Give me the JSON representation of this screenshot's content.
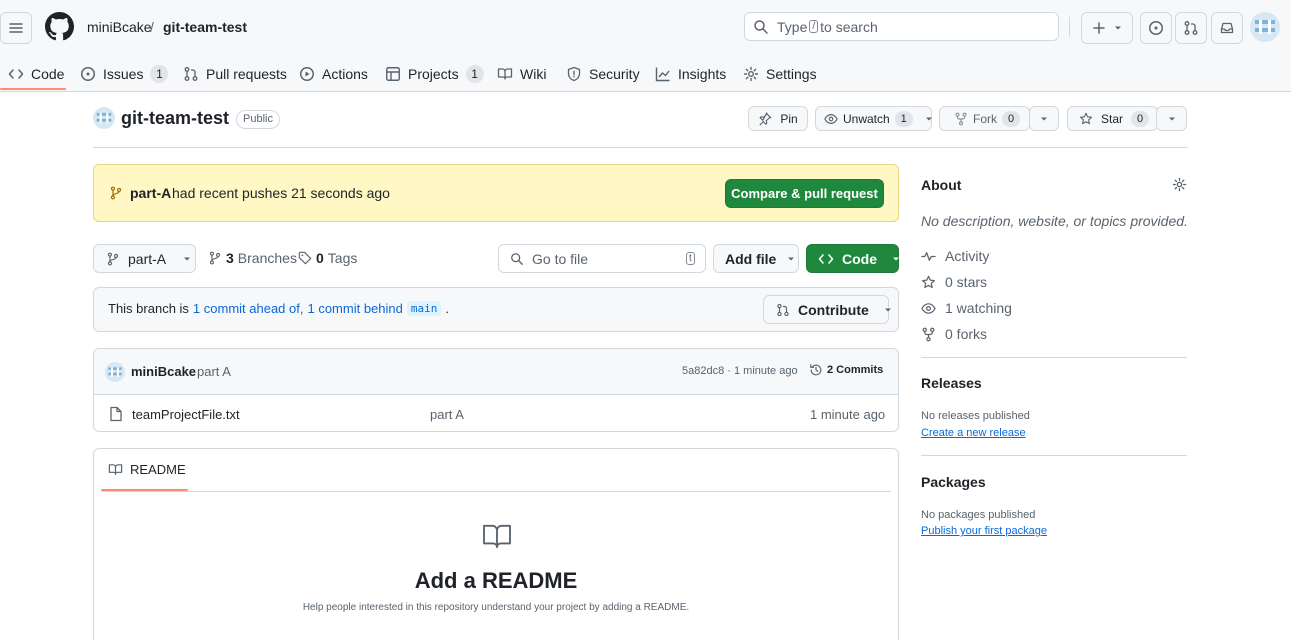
{
  "header": {
    "owner": "miniBcake",
    "separator": "/",
    "repo": "git-team-test",
    "search_prefix": "Type",
    "search_key": "/",
    "search_suffix": "to search"
  },
  "tabs": [
    {
      "label": "Code",
      "icon": "code-icon"
    },
    {
      "label": "Issues",
      "icon": "issue-opened-icon",
      "count": "1"
    },
    {
      "label": "Pull requests",
      "icon": "git-pull-request-icon"
    },
    {
      "label": "Actions",
      "icon": "play-icon"
    },
    {
      "label": "Projects",
      "icon": "table-icon",
      "count": "1"
    },
    {
      "label": "Wiki",
      "icon": "book-icon"
    },
    {
      "label": "Security",
      "icon": "shield-icon"
    },
    {
      "label": "Insights",
      "icon": "graph-icon"
    },
    {
      "label": "Settings",
      "icon": "gear-icon"
    }
  ],
  "repo_header": {
    "name": "git-team-test",
    "visibility": "Public",
    "pin_label": "Pin",
    "unwatch_label": "Unwatch",
    "watch_count": "1",
    "fork_label": "Fork",
    "fork_count": "0",
    "star_label": "Star",
    "star_count": "0"
  },
  "banner": {
    "branch": "part-A",
    "text": "had recent pushes 21 seconds ago",
    "button": "Compare & pull request"
  },
  "toolbar": {
    "branch": "part-A",
    "branches_count": "3",
    "branches_label": "Branches",
    "tags_count": "0",
    "tags_label": "Tags",
    "goto_placeholder": "Go to file",
    "goto_key": "t",
    "add_file": "Add file",
    "code": "Code"
  },
  "branch_status": {
    "prefix": "This branch is",
    "ahead": "1 commit ahead of,",
    "behind": "1 commit behind",
    "base": "main",
    "suffix": ".",
    "contribute": "Contribute"
  },
  "latest_commit": {
    "author": "miniBcake",
    "message": "part A",
    "sha_time": "5a82dc8 · 1 minute ago",
    "commits_label": "2 Commits"
  },
  "files": [
    {
      "name": "teamProjectFile.txt",
      "message": "part A",
      "time": "1 minute ago"
    }
  ],
  "readme": {
    "tab": "README",
    "title": "Add a README",
    "description": "Help people interested in this repository understand your project by adding a README."
  },
  "about": {
    "title": "About",
    "description": "No description, website, or topics provided.",
    "activity": "Activity",
    "stars": "0 stars",
    "watching": "1 watching",
    "forks": "0 forks"
  },
  "releases": {
    "title": "Releases",
    "empty": "No releases published",
    "link": "Create a new release"
  },
  "packages": {
    "title": "Packages",
    "empty": "No packages published",
    "link": "Publish your first package"
  },
  "colors": {
    "accent_green": "#1f883d",
    "link_blue": "#0969da",
    "tab_underline": "#fd8c73",
    "banner_bg": "#fff8c5"
  }
}
